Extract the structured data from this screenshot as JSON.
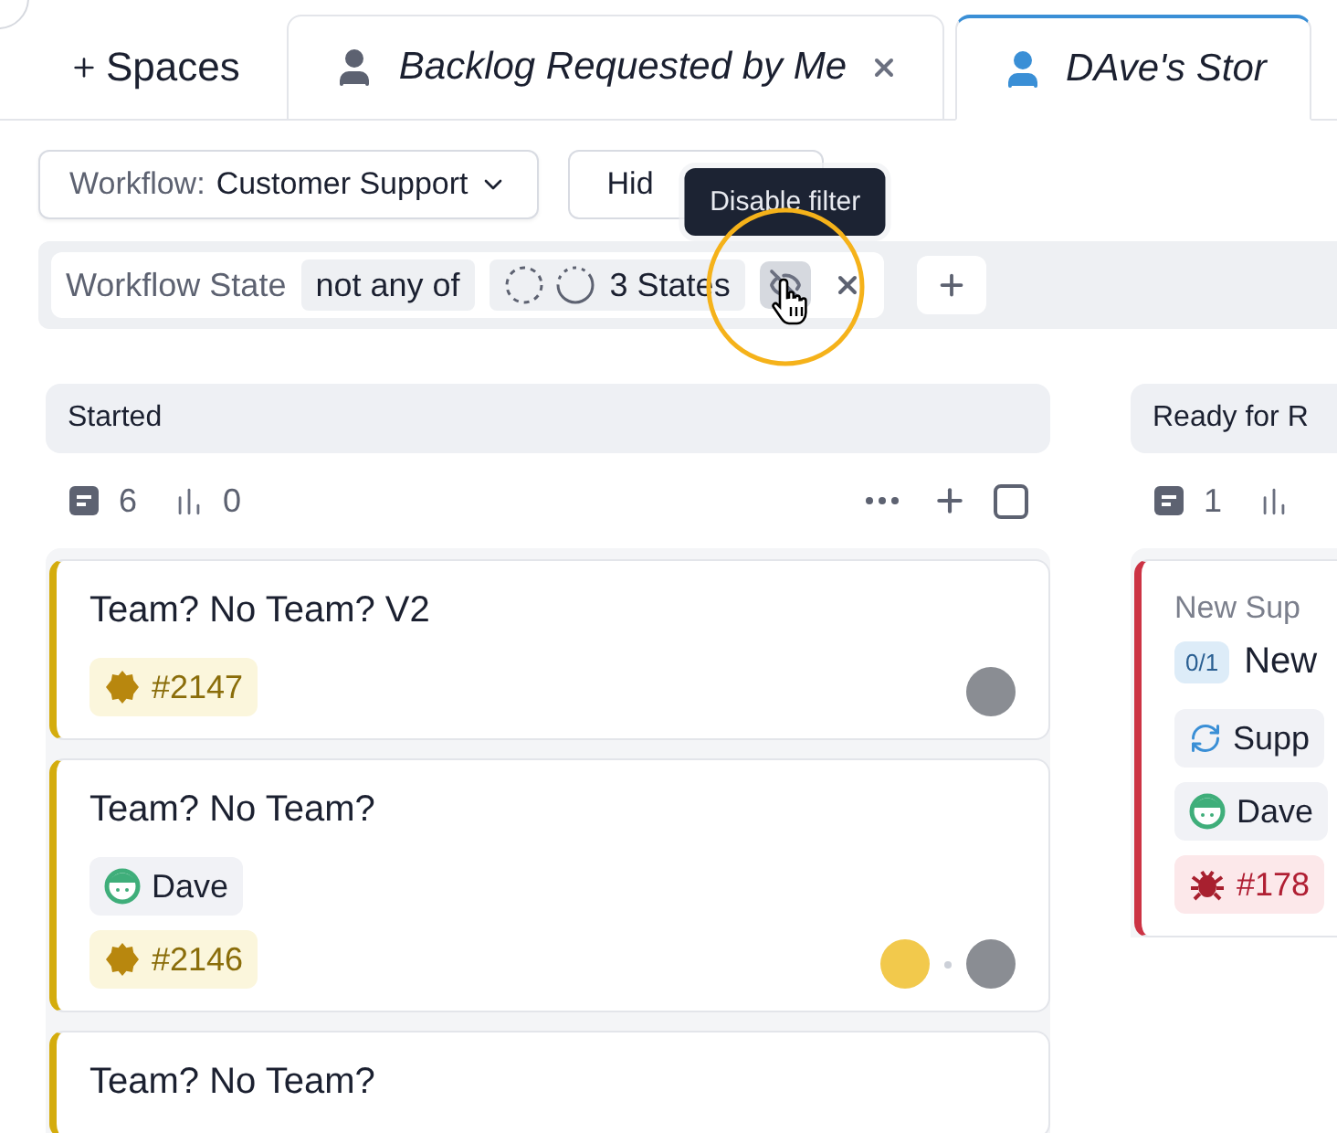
{
  "tabs": [
    {
      "kind": "add",
      "label": "Spaces",
      "selected": false
    },
    {
      "kind": "space",
      "label": "Backlog Requested by Me",
      "closable": true,
      "selected": false
    },
    {
      "kind": "space",
      "label": "DAve's Stor",
      "closable": false,
      "selected": true
    }
  ],
  "toolbar": {
    "workflow": {
      "label": "Workflow:",
      "value": "Customer Support"
    },
    "hide_button": "Hid",
    "tooltip": "Disable filter"
  },
  "filter": {
    "field": "Workflow State",
    "operator": "not any of",
    "value": "3 States"
  },
  "columns": [
    {
      "title": "Started",
      "stories": "6",
      "points": "0",
      "select_all": {
        "checked": false
      },
      "cards": [
        {
          "title": "Team? No Team? V2",
          "color": "#d4ac0d",
          "chips": [
            {
              "kind": "feature",
              "label": "#2147"
            }
          ],
          "avatars": [
            {
              "kind": "person"
            }
          ]
        },
        {
          "title": "Team? No Team?",
          "color": "#d4ac0d",
          "chips": [
            {
              "kind": "owner",
              "label": "Dave"
            },
            {
              "kind": "feature",
              "label": "#2146"
            }
          ],
          "avatars": [
            {
              "kind": "mascot"
            },
            {
              "kind": "person"
            }
          ]
        },
        {
          "title": "Team? No Team?",
          "color": "#d4ac0d"
        }
      ]
    },
    {
      "title": "Ready for R",
      "stories": "1",
      "cards": [
        {
          "subtitle": "New Sup",
          "progress": "0/1",
          "title": "New",
          "color": "#cc3344",
          "chips": [
            {
              "kind": "epic",
              "label": "Supp"
            },
            {
              "kind": "owner",
              "label": "Dave"
            },
            {
              "kind": "bug",
              "label": "#178"
            }
          ]
        }
      ]
    }
  ]
}
